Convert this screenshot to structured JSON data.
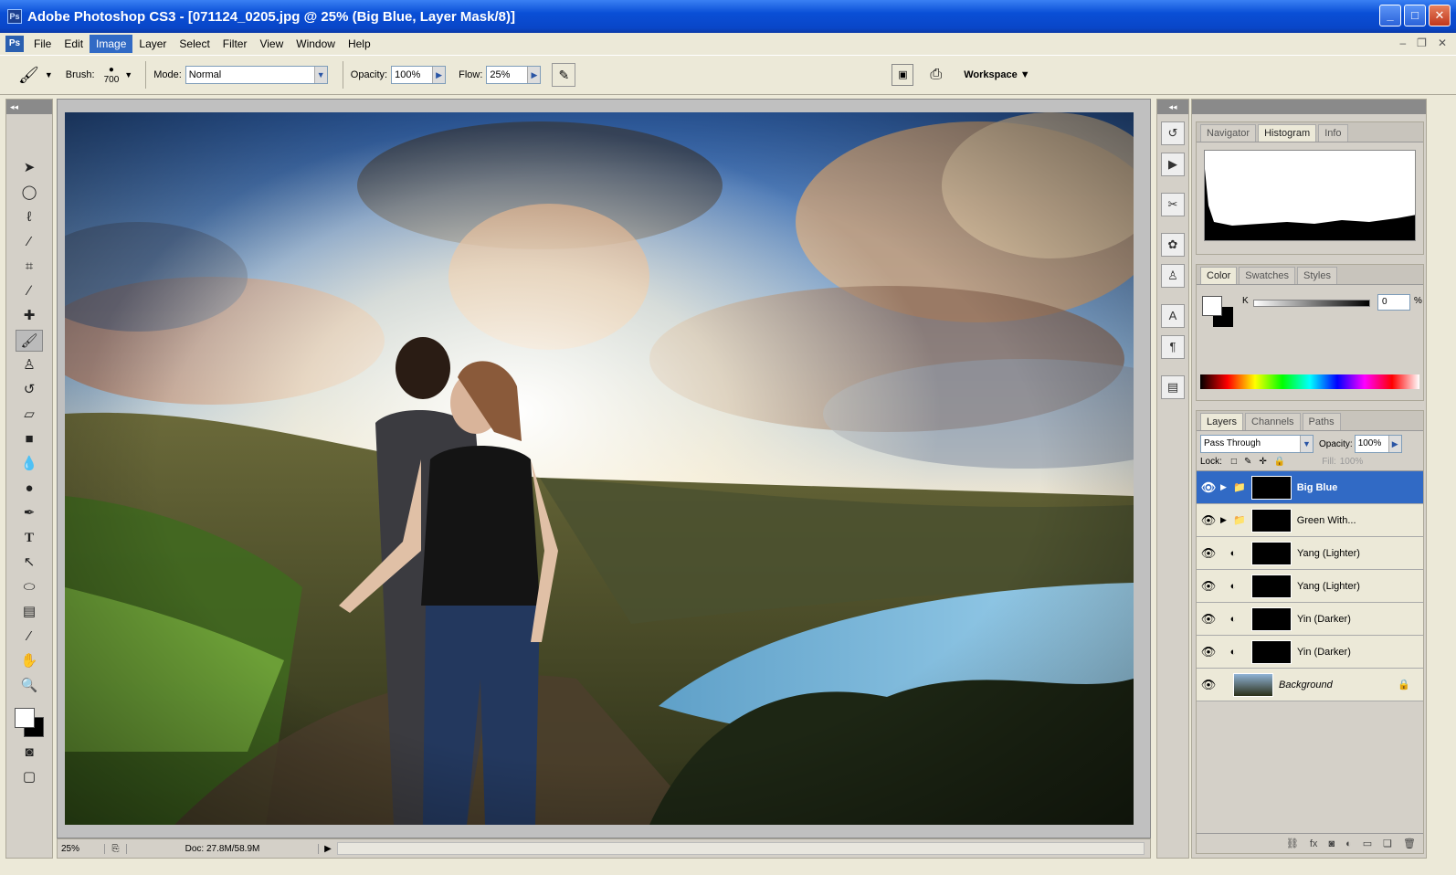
{
  "window": {
    "title": "Adobe Photoshop CS3 - [071124_0205.jpg @ 25% (Big Blue, Layer Mask/8)]",
    "app_icon": "Ps",
    "buttons": [
      "_",
      "□",
      "✕"
    ]
  },
  "menu": {
    "items": [
      "File",
      "Edit",
      "Image",
      "Layer",
      "Select",
      "Filter",
      "View",
      "Window",
      "Help"
    ],
    "active": "Image"
  },
  "options": {
    "brush_label": "Brush:",
    "brush_size": "700",
    "mode_label": "Mode:",
    "mode_value": "Normal",
    "opacity_label": "Opacity:",
    "opacity_value": "100%",
    "flow_label": "Flow:",
    "flow_value": "25%",
    "workspace_label": "Workspace"
  },
  "tools": [
    "move-tool",
    "marquee-tool",
    "lasso-tool",
    "magic-wand-tool",
    "crop-tool",
    "slice-tool",
    "healing-tool",
    "brush-tool",
    "clone-stamp-tool",
    "history-brush-tool",
    "eraser-tool",
    "gradient-tool",
    "blur-tool",
    "dodge-tool",
    "pen-tool",
    "type-tool",
    "path-selection-tool",
    "shape-tool",
    "notes-tool",
    "eyedropper-tool",
    "hand-tool",
    "zoom-tool"
  ],
  "status": {
    "zoom": "25%",
    "doc": "Doc: 27.8M/58.9M"
  },
  "panels": {
    "top_tabs": [
      "Navigator",
      "Histogram",
      "Info"
    ],
    "top_active": "Histogram",
    "color_tabs": [
      "Color",
      "Swatches",
      "Styles"
    ],
    "color_active": "Color",
    "color_k_label": "K",
    "color_k_value": "0",
    "color_k_unit": "%",
    "layers_tabs": [
      "Layers",
      "Channels",
      "Paths"
    ],
    "layers_active": "Layers",
    "blend_mode": "Pass Through",
    "opacity_label": "Opacity:",
    "opacity_value": "100%",
    "lock_label": "Lock:",
    "fill_label": "Fill:",
    "fill_value": "100%"
  },
  "layers": [
    {
      "name": "Big Blue",
      "type": "group",
      "selected": true
    },
    {
      "name": "Green With...",
      "type": "group",
      "selected": false
    },
    {
      "name": "Yang (Lighter)",
      "type": "adjustment",
      "selected": false
    },
    {
      "name": "Yang (Lighter)",
      "type": "adjustment",
      "selected": false
    },
    {
      "name": "Yin (Darker)",
      "type": "adjustment",
      "selected": false
    },
    {
      "name": "Yin (Darker)",
      "type": "adjustment",
      "selected": false
    },
    {
      "name": "Background",
      "type": "background",
      "selected": false
    }
  ],
  "colors": {
    "titlebar": "#0a4fd6",
    "selection": "#316ac5",
    "chrome": "#d4d0c8"
  }
}
